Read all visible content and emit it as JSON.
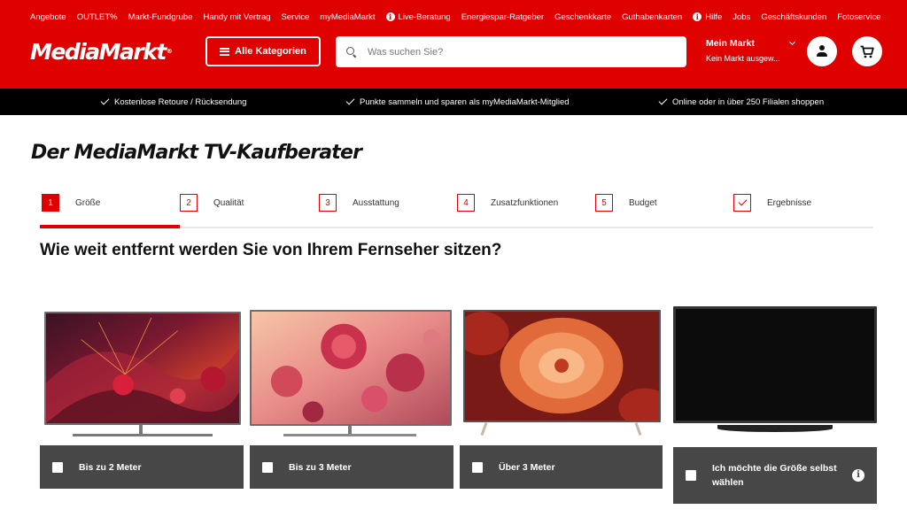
{
  "topnav": [
    {
      "label": "Angebote",
      "info": false
    },
    {
      "label": "OUTLET%",
      "info": false
    },
    {
      "label": "Markt-Fundgrube",
      "info": false
    },
    {
      "label": "Handy mit Vertrag",
      "info": false
    },
    {
      "label": "Service",
      "info": false
    },
    {
      "label": "myMediaMarkt",
      "info": false
    },
    {
      "label": "Live-Beratung",
      "info": true
    },
    {
      "label": "Energiespar-Ratgeber",
      "info": false
    },
    {
      "label": "Geschenkkarte",
      "info": false
    },
    {
      "label": "Guthabenkarten",
      "info": false
    },
    {
      "label": "Hilfe",
      "info": true
    },
    {
      "label": "Jobs",
      "info": false
    },
    {
      "label": "Geschäftskunden",
      "info": false
    },
    {
      "label": "Fotoservice",
      "info": false
    }
  ],
  "header": {
    "logo_text": "MediaMarkt",
    "logo_reg": "®",
    "categories_label": "Alle Kategorien",
    "search_placeholder": "Was suchen Sie?",
    "market_title": "Mein Markt",
    "market_sub": "Kein Markt ausgew...",
    "accent": "#df0000"
  },
  "benefits": [
    "Kostenlose Retoure / Rücksendung",
    "Punkte sammeln und sparen als myMediaMarkt-Mitglied",
    "Online oder in über 250 Filialen shoppen"
  ],
  "page_title": "Der MediaMarkt TV-Kaufberater",
  "steps": [
    {
      "num": "1",
      "label": "Größe",
      "active": true
    },
    {
      "num": "2",
      "label": "Qualität",
      "active": false
    },
    {
      "num": "3",
      "label": "Ausstattung",
      "active": false
    },
    {
      "num": "4",
      "label": "Zusatzfunktionen",
      "active": false
    },
    {
      "num": "5",
      "label": "Budget",
      "active": false
    },
    {
      "num": "",
      "label": "Ergebnisse",
      "active": false,
      "icon": "check-icon"
    }
  ],
  "question": "Wie weit entfernt werden Sie von Ihrem Fernseher sitzen?",
  "options": [
    {
      "label": "Bis zu 2 Meter",
      "checked": false
    },
    {
      "label": "Bis zu 3 Meter",
      "checked": false
    },
    {
      "label": "Über 3 Meter",
      "checked": false
    },
    {
      "label": "Ich möchte die Größe selbst wählen",
      "checked": false,
      "info": true
    }
  ]
}
